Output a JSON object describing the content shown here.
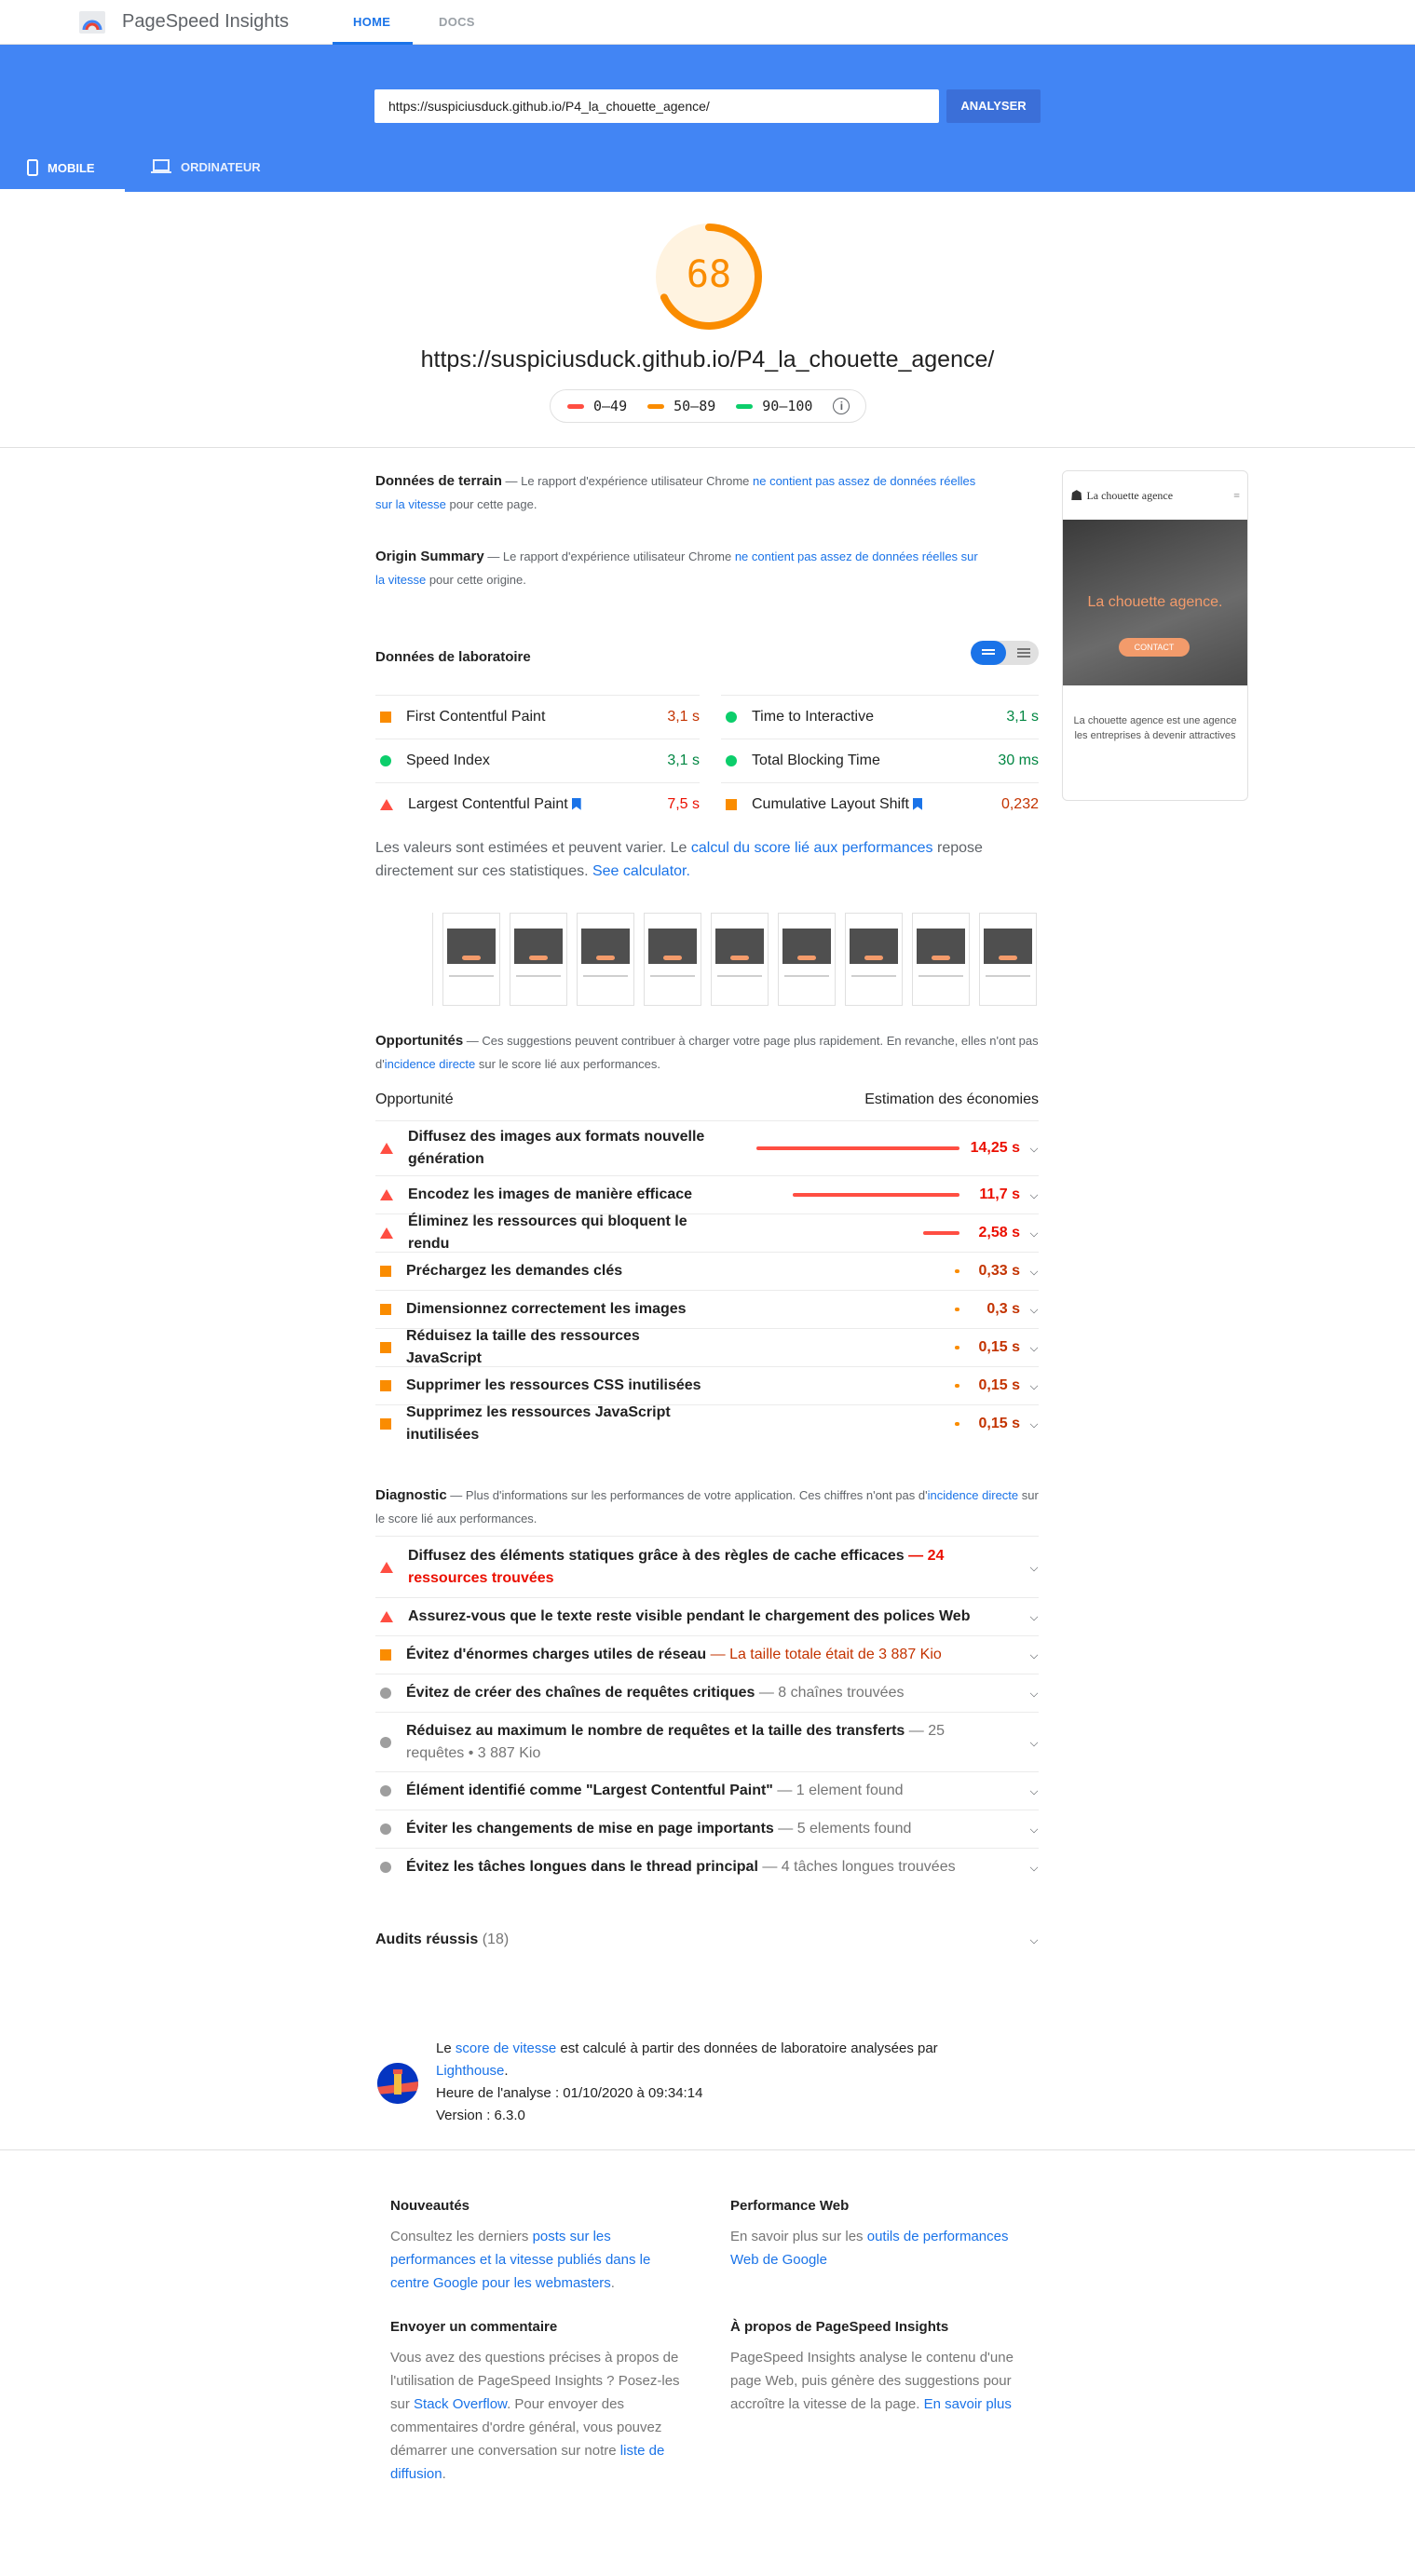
{
  "header": {
    "app_title": "PageSpeed Insights",
    "nav": [
      "HOME",
      "DOCS"
    ]
  },
  "search": {
    "url": "https://suspiciusduck.github.io/P4_la_chouette_agence/",
    "analyze_label": "ANALYSER"
  },
  "device_tabs": [
    "MOBILE",
    "ORDINATEUR"
  ],
  "score": {
    "value": "68",
    "value_num": 68,
    "url": "https://suspiciusduck.github.io/P4_la_chouette_agence/",
    "legend": [
      "0–49",
      "50–89",
      "90–100"
    ],
    "color": "#fa8c00"
  },
  "field": {
    "title": "Données de terrain",
    "desc_a": " — Le rapport d'expérience utilisateur Chrome ",
    "link": "ne contient pas assez de données réelles sur la vitesse",
    "desc_b": " pour cette page."
  },
  "origin": {
    "title": "Origin Summary",
    "desc_a": " — Le rapport d'expérience utilisateur Chrome ",
    "link": "ne contient pas assez de données réelles sur la vitesse",
    "desc_b": " pour cette origine."
  },
  "lab": {
    "title": "Données de laboratoire",
    "metrics": [
      {
        "label": "First Contentful Paint",
        "value": "3,1 s",
        "status": "average"
      },
      {
        "label": "Time to Interactive",
        "value": "3,1 s",
        "status": "pass"
      },
      {
        "label": "Speed Index",
        "value": "3,1 s",
        "status": "pass"
      },
      {
        "label": "Total Blocking Time",
        "value": "30 ms",
        "status": "pass"
      },
      {
        "label": "Largest Contentful Paint",
        "value": "7,5 s",
        "status": "fail"
      },
      {
        "label": "Cumulative Layout Shift",
        "value": "0,232",
        "status": "average"
      }
    ],
    "estimate_a": "Les valeurs sont estimées et peuvent varier. Le ",
    "estimate_link": "calcul du score lié aux performances",
    "estimate_b": " repose directement sur ces statistiques. ",
    "estimate_link2": "See calculator."
  },
  "screenshot": {
    "site_title": "La chouette agence",
    "hero_text": "La chouette agence.",
    "cta": "CONTACT",
    "body": "La chouette agence est une agence les entreprises à devenir attractives"
  },
  "opportunities": {
    "title": "Opportunités",
    "desc_a": " — Ces suggestions peuvent contribuer à charger votre page plus rapidement. En revanche, elles n'ont pas d'",
    "desc_link": "incidence directe",
    "desc_b": " sur le score lié aux performances.",
    "col_left": "Opportunité",
    "col_right": "Estimation des économies",
    "items": [
      {
        "title": "Diffusez des images aux formats nouvelle génération",
        "saving": "14,25 s",
        "seconds": 14.25,
        "status": "fail"
      },
      {
        "title": "Encodez les images de manière efficace",
        "saving": "11,7 s",
        "seconds": 11.7,
        "status": "fail"
      },
      {
        "title": "Éliminez les ressources qui bloquent le rendu",
        "saving": "2,58 s",
        "seconds": 2.58,
        "status": "fail"
      },
      {
        "title": "Préchargez les demandes clés",
        "saving": "0,33 s",
        "seconds": 0.33,
        "status": "average"
      },
      {
        "title": "Dimensionnez correctement les images",
        "saving": "0,3 s",
        "seconds": 0.3,
        "status": "average"
      },
      {
        "title": "Réduisez la taille des ressources JavaScript",
        "saving": "0,15 s",
        "seconds": 0.15,
        "status": "average"
      },
      {
        "title": "Supprimer les ressources CSS inutilisées",
        "saving": "0,15 s",
        "seconds": 0.15,
        "status": "average"
      },
      {
        "title": "Supprimez les ressources JavaScript inutilisées",
        "saving": "0,15 s",
        "seconds": 0.15,
        "status": "average"
      }
    ]
  },
  "diagnostic": {
    "title": "Diagnostic",
    "desc_a": " — Plus d'informations sur les performances de votre application. Ces chiffres n'ont pas d'",
    "desc_link": "incidence directe",
    "desc_b": " sur le score lié aux performances.",
    "items": [
      {
        "title": "Diffusez des éléments statiques grâce à des règles de cache efficaces",
        "detail": " — 24 ressources trouvées",
        "status": "fail"
      },
      {
        "title": "Assurez-vous que le texte reste visible pendant le chargement des polices Web",
        "detail": "",
        "status": "fail"
      },
      {
        "title": "Évitez d'énormes charges utiles de réseau",
        "detail": " — La taille totale était de 3 887 Kio",
        "status": "average"
      },
      {
        "title": "Évitez de créer des chaînes de requêtes critiques",
        "detail": " — 8 chaînes trouvées",
        "status": "info"
      },
      {
        "title": "Réduisez au maximum le nombre de requêtes et la taille des transferts",
        "detail": " — 25 requêtes • 3 887 Kio",
        "status": "info"
      },
      {
        "title": "Élément identifié comme \"Largest Contentful Paint\"",
        "detail": " — 1 element found",
        "status": "info"
      },
      {
        "title": "Éviter les changements de mise en page importants",
        "detail": " — 5 elements found",
        "status": "info"
      },
      {
        "title": "Évitez les tâches longues dans le thread principal",
        "detail": " — 4 tâches longues trouvées",
        "status": "info"
      }
    ]
  },
  "passed": {
    "title": "Audits réussis",
    "count": "(18)"
  },
  "lighthouse": {
    "a": "Le ",
    "link": "score de vitesse",
    "b": " est calculé à partir des données de laboratoire analysées par ",
    "link2": "Lighthouse",
    "c": ".",
    "time": "Heure de l'analyse : 01/10/2020 à 09:34:14",
    "version": "Version : 6.3.0"
  },
  "footer": {
    "news": {
      "h": "Nouveautés",
      "a": "Consultez les derniers ",
      "link": "posts sur les performances et la vitesse publiés dans le centre Google pour les webmasters",
      "b": "."
    },
    "perf": {
      "h": "Performance Web",
      "a": "En savoir plus sur les ",
      "link": "outils de performances Web de Google"
    },
    "feedback": {
      "h": "Envoyer un commentaire",
      "a": "Vous avez des questions précises à propos de l'utilisation de PageSpeed Insights ? Posez-les sur ",
      "link": "Stack Overflow",
      "b": ". Pour envoyer des commentaires d'ordre général, vous pouvez démarrer une conversation sur notre ",
      "link2": "liste de diffusion",
      "c": "."
    },
    "about": {
      "h": "À propos de PageSpeed Insights",
      "a": "PageSpeed Insights analyse le contenu d'une page Web, puis génère des suggestions pour accroître la vitesse de la page. ",
      "link": "En savoir plus"
    }
  },
  "colors": {
    "blue": "#4285f4",
    "pass": "#0cce6b",
    "average": "#fa8c00",
    "fail": "#ff4e42"
  }
}
